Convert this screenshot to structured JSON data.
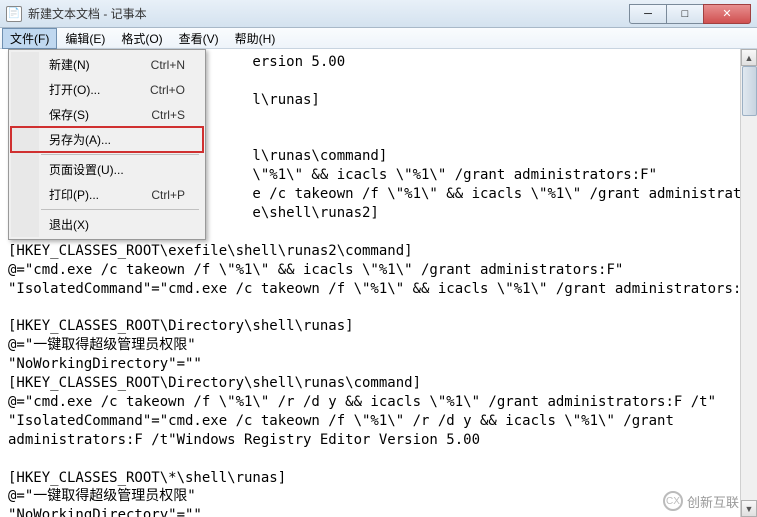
{
  "window": {
    "title": "新建文本文档 - 记事本"
  },
  "menubar": {
    "items": [
      {
        "label": "文件(F)"
      },
      {
        "label": "编辑(E)"
      },
      {
        "label": "格式(O)"
      },
      {
        "label": "查看(V)"
      },
      {
        "label": "帮助(H)"
      }
    ]
  },
  "dropdown": {
    "items": [
      {
        "label": "新建(N)",
        "shortcut": "Ctrl+N"
      },
      {
        "label": "打开(O)...",
        "shortcut": "Ctrl+O"
      },
      {
        "label": "保存(S)",
        "shortcut": "Ctrl+S"
      },
      {
        "label": "另存为(A)...",
        "shortcut": "",
        "highlighted": true
      },
      {
        "sep": true
      },
      {
        "label": "页面设置(U)...",
        "shortcut": ""
      },
      {
        "label": "打印(P)...",
        "shortcut": "Ctrl+P"
      },
      {
        "sep": true
      },
      {
        "label": "退出(X)",
        "shortcut": ""
      }
    ]
  },
  "content": {
    "text": "                             ersion 5.00\n\n                             l\\runas]\n\n\n                             l\\runas\\command]\n                             \\\"%1\\\" && icacls \\\"%1\\\" /grant administrators:F\"\n                             e /c takeown /f \\\"%1\\\" && icacls \\\"%1\\\" /grant administrators:F\"\n                             e\\shell\\runas2]\n\n[HKEY_CLASSES_ROOT\\exefile\\shell\\runas2\\command]\n@=\"cmd.exe /c takeown /f \\\"%1\\\" && icacls \\\"%1\\\" /grant administrators:F\"\n\"IsolatedCommand\"=\"cmd.exe /c takeown /f \\\"%1\\\" && icacls \\\"%1\\\" /grant administrators:F\"\n\n[HKEY_CLASSES_ROOT\\Directory\\shell\\runas]\n@=\"一键取得超级管理员权限\"\n\"NoWorkingDirectory\"=\"\"\n[HKEY_CLASSES_ROOT\\Directory\\shell\\runas\\command]\n@=\"cmd.exe /c takeown /f \\\"%1\\\" /r /d y && icacls \\\"%1\\\" /grant administrators:F /t\"\n\"IsolatedCommand\"=\"cmd.exe /c takeown /f \\\"%1\\\" /r /d y && icacls \\\"%1\\\" /grant\nadministrators:F /t\"Windows Registry Editor Version 5.00\n\n[HKEY_CLASSES_ROOT\\*\\shell\\runas]\n@=\"一键取得超级管理员权限\"\n\"NoWorkingDirectory\"=\"\"\n[HKEY_CLASSES_ROOT\\*\\shell\\runas\\command]\n@=\"cmd.exe /c takeown /f \\\"%1\\\" && icacls \\\"%1\\\" /grant administrators:F\""
  },
  "watermark": {
    "text": "创新互联"
  }
}
